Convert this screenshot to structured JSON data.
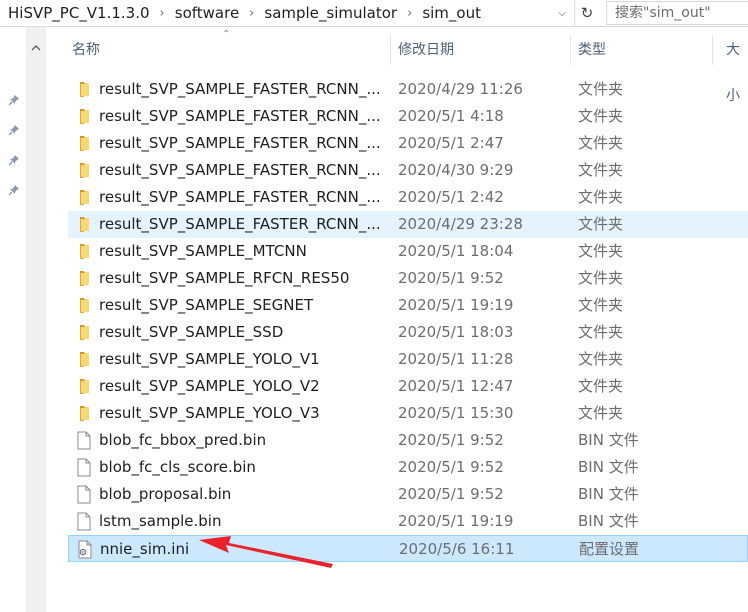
{
  "address_bar": {
    "breadcrumbs": [
      "HiSVP_PC_V1.1.3.0",
      "software",
      "sample_simulator",
      "sim_out"
    ],
    "search_placeholder": "搜索\"sim_out\""
  },
  "columns": {
    "name": "名称",
    "date": "修改日期",
    "type": "类型",
    "size": "大小"
  },
  "files": [
    {
      "name": "result_SVP_SAMPLE_FASTER_RCNN_...",
      "date": "2020/4/29 11:26",
      "type": "文件夹",
      "icon": "folder-icon"
    },
    {
      "name": "result_SVP_SAMPLE_FASTER_RCNN_...",
      "date": "2020/5/1 4:18",
      "type": "文件夹",
      "icon": "folder-icon"
    },
    {
      "name": "result_SVP_SAMPLE_FASTER_RCNN_...",
      "date": "2020/5/1 2:47",
      "type": "文件夹",
      "icon": "folder-icon"
    },
    {
      "name": "result_SVP_SAMPLE_FASTER_RCNN_...",
      "date": "2020/4/30 9:29",
      "type": "文件夹",
      "icon": "folder-icon"
    },
    {
      "name": "result_SVP_SAMPLE_FASTER_RCNN_...",
      "date": "2020/5/1 2:42",
      "type": "文件夹",
      "icon": "folder-icon"
    },
    {
      "name": "result_SVP_SAMPLE_FASTER_RCNN_...",
      "date": "2020/4/29 23:28",
      "type": "文件夹",
      "icon": "folder-icon",
      "state": "hover"
    },
    {
      "name": "result_SVP_SAMPLE_MTCNN",
      "date": "2020/5/1 18:04",
      "type": "文件夹",
      "icon": "folder-icon"
    },
    {
      "name": "result_SVP_SAMPLE_RFCN_RES50",
      "date": "2020/5/1 9:52",
      "type": "文件夹",
      "icon": "folder-icon"
    },
    {
      "name": "result_SVP_SAMPLE_SEGNET",
      "date": "2020/5/1 19:19",
      "type": "文件夹",
      "icon": "folder-icon"
    },
    {
      "name": "result_SVP_SAMPLE_SSD",
      "date": "2020/5/1 18:03",
      "type": "文件夹",
      "icon": "folder-icon"
    },
    {
      "name": "result_SVP_SAMPLE_YOLO_V1",
      "date": "2020/5/1 11:28",
      "type": "文件夹",
      "icon": "folder-icon"
    },
    {
      "name": "result_SVP_SAMPLE_YOLO_V2",
      "date": "2020/5/1 12:47",
      "type": "文件夹",
      "icon": "folder-icon"
    },
    {
      "name": "result_SVP_SAMPLE_YOLO_V3",
      "date": "2020/5/1 15:30",
      "type": "文件夹",
      "icon": "folder-icon"
    },
    {
      "name": "blob_fc_bbox_pred.bin",
      "date": "2020/5/1 9:52",
      "type": "BIN 文件",
      "icon": "file-icon"
    },
    {
      "name": "blob_fc_cls_score.bin",
      "date": "2020/5/1 9:52",
      "type": "BIN 文件",
      "icon": "file-icon"
    },
    {
      "name": "blob_proposal.bin",
      "date": "2020/5/1 9:52",
      "type": "BIN 文件",
      "icon": "file-icon"
    },
    {
      "name": "lstm_sample.bin",
      "date": "2020/5/1 19:19",
      "type": "BIN 文件",
      "icon": "file-icon"
    },
    {
      "name": "nnie_sim.ini",
      "date": "2020/5/6 16:11",
      "type": "配置设置",
      "icon": "config-icon",
      "state": "selected"
    }
  ],
  "colors": {
    "selected_bg": "#cce8ff",
    "hover_bg": "#e5f3ff",
    "folder": "#f8d775",
    "annotation_arrow": "#e8242a"
  },
  "icons": [
    "pin-icon",
    "folder-icon",
    "file-icon",
    "config-icon",
    "sort-ascending-icon",
    "refresh-icon",
    "chevron-down-icon"
  ]
}
